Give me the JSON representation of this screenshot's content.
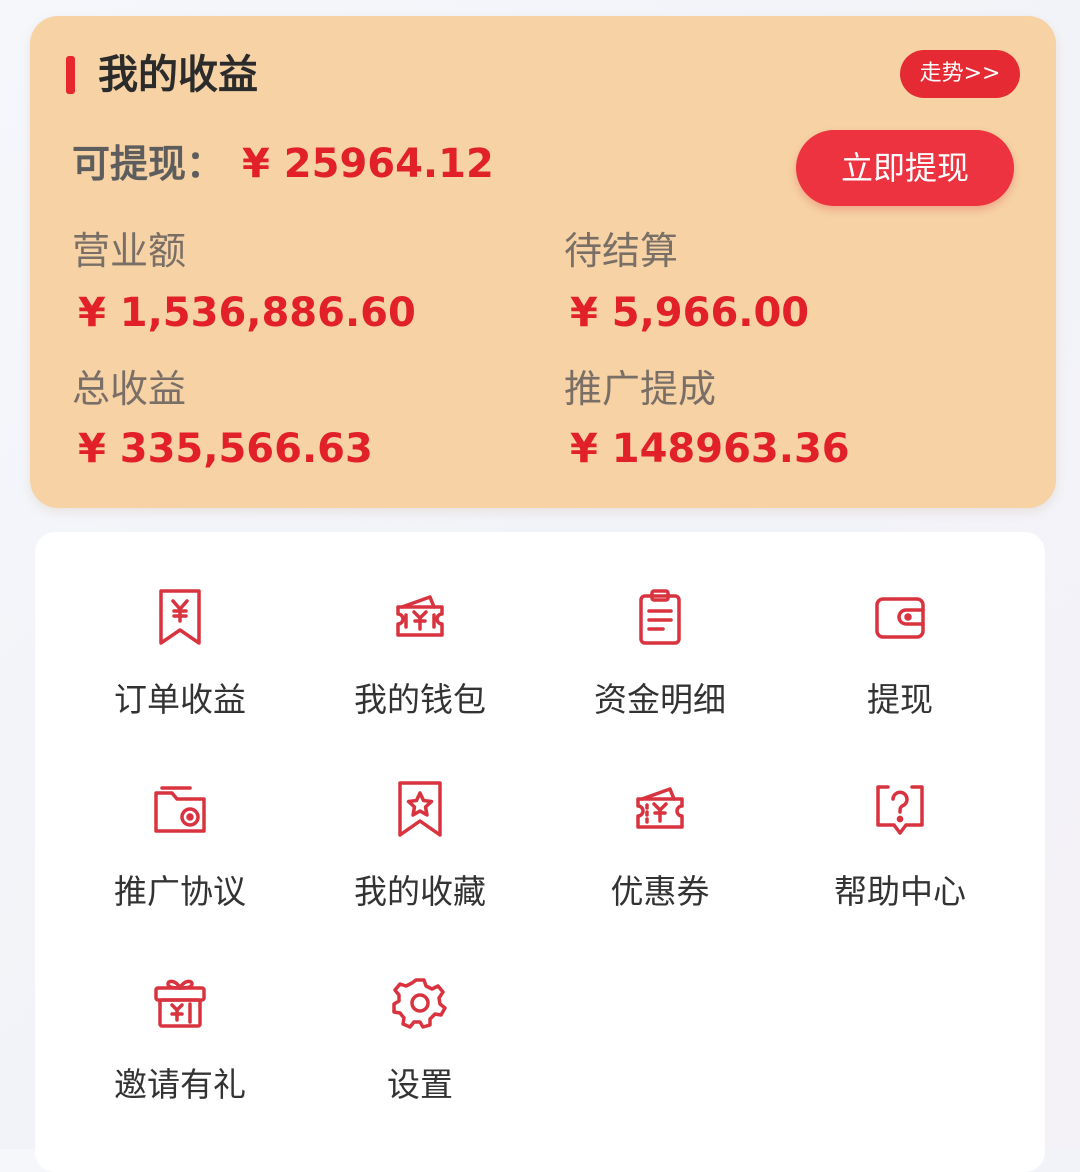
{
  "colors": {
    "card_background": "#f6d2a5",
    "accent_red": "#e62a34",
    "value_red": "#e1202a",
    "icon_red": "#d9333f"
  },
  "earnings": {
    "title": "我的收益",
    "trend_button": "走势>>",
    "available_label": "可提现：",
    "available_value": "¥ 25964.12",
    "withdraw_button": "立即提现",
    "stats": [
      {
        "label": "营业额",
        "value": "¥ 1,536,886.60"
      },
      {
        "label": "待结算",
        "value": "¥ 5,966.00"
      },
      {
        "label": "总收益",
        "value": "¥ 335,566.63"
      },
      {
        "label": "推广提成",
        "value": "¥ 148963.36"
      }
    ]
  },
  "menu": {
    "items": [
      {
        "label": "订单收益",
        "icon": "receipt-yen-icon"
      },
      {
        "label": "我的钱包",
        "icon": "wallet-ticket-icon"
      },
      {
        "label": "资金明细",
        "icon": "clipboard-list-icon"
      },
      {
        "label": "提现",
        "icon": "wallet-icon"
      },
      {
        "label": "推广协议",
        "icon": "folder-disc-icon"
      },
      {
        "label": "我的收藏",
        "icon": "bookmark-star-icon"
      },
      {
        "label": "优惠券",
        "icon": "coupon-icon"
      },
      {
        "label": "帮助中心",
        "icon": "help-chat-icon"
      },
      {
        "label": "邀请有礼",
        "icon": "gift-icon"
      },
      {
        "label": "设置",
        "icon": "gear-icon"
      }
    ]
  }
}
